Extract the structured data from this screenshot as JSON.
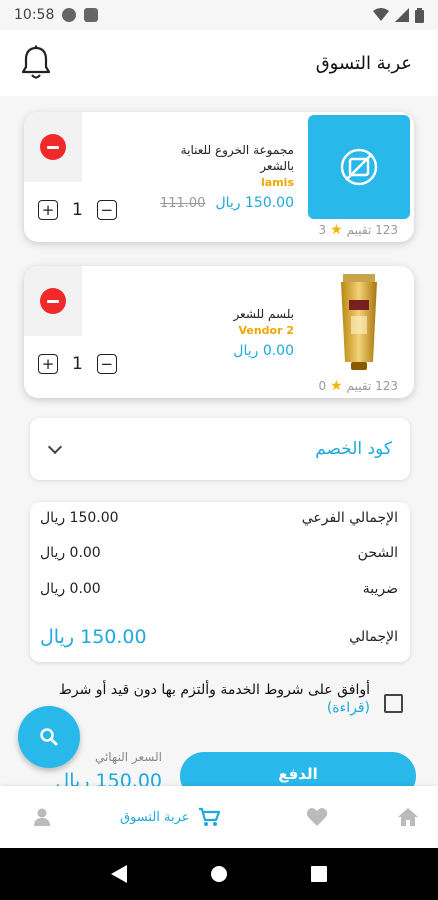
{
  "status_bar": {
    "time": "10:58"
  },
  "header": {
    "title": "عربة التسوق"
  },
  "cart_items": [
    {
      "name": "مجموعة الخروع للعناية بالشعر",
      "vendor": "lamis",
      "price": "150.00 ريال",
      "old_price": "111.00",
      "quantity": "1",
      "rating_count": "123 تقييم",
      "rating_value": "3"
    },
    {
      "name": "بلسم للشعر",
      "vendor": "Vendor 2",
      "price": "0.00 ريال",
      "quantity": "1",
      "rating_count": "123 تقييم",
      "rating_value": "0"
    }
  ],
  "coupon": {
    "label": "كود الخصم"
  },
  "summary": {
    "subtotal_label": "الإجمالي الفرعي",
    "subtotal_value": "150.00 ريال",
    "shipping_label": "الشحن",
    "shipping_value": "0.00 ريال",
    "tax_label": "ضريبة",
    "tax_value": "0.00 ريال",
    "total_label": "الإجمالي",
    "total_value": "150.00 ريال"
  },
  "terms": {
    "text": "أوافق على شروط الخدمة وألتزم بها دون قيد أو شرط",
    "read_link": "(قراءة)"
  },
  "checkout": {
    "pay_label": "الدفع",
    "final_price_label": "السعر النهائي",
    "final_price_value": "150.00 ريال"
  },
  "bottom_nav": {
    "cart_label": "عربة التسوق"
  },
  "colors": {
    "accent": "#28b8ea",
    "danger": "#f0292b",
    "vendor": "#f5a500"
  }
}
